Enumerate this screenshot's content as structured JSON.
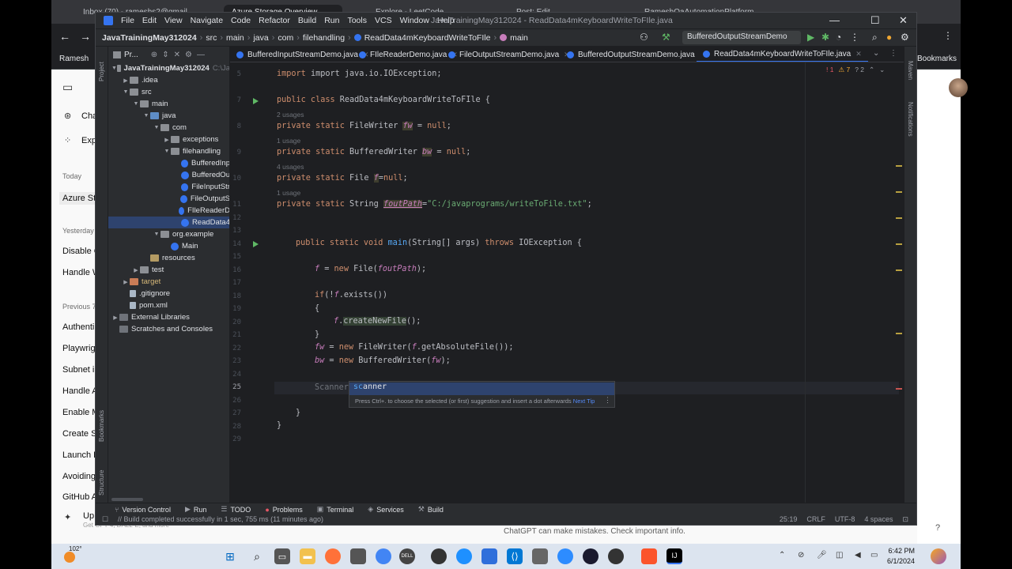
{
  "browser": {
    "tabs": [
      {
        "label": "Inbox (70) - rameshs2@gmail..."
      },
      {
        "label": "Azure Storage Overview"
      },
      {
        "label": "Explore - LeetCode"
      },
      {
        "label": "Post: Edit"
      },
      {
        "label": "RameshQaAutomationPlatform"
      }
    ],
    "bookmarks_left": "Ramesh",
    "bookmarks_right": "Bookmarks"
  },
  "chat_sidebar": {
    "top_items": [
      "Cha",
      "Exp"
    ],
    "sections": [
      {
        "heading": "Today",
        "items": [
          "Azure Sto"
        ]
      },
      {
        "heading": "Yesterday",
        "items": [
          "Disable C",
          "Handle W"
        ]
      },
      {
        "heading": "Previous 7",
        "items": [
          "Authenti",
          "Playwrigh",
          "Subnet in",
          "Handle A",
          "Enable M",
          "Create SC",
          "Launch B",
          "Avoiding",
          "GitHub A"
        ]
      }
    ],
    "upgrade_label": "Up",
    "upgrade_sub": "Get GPT-4, DALL·E, and more",
    "footer": "ChatGPT can make mistakes. Check important info."
  },
  "ide": {
    "menu": [
      "File",
      "Edit",
      "View",
      "Navigate",
      "Code",
      "Refactor",
      "Build",
      "Run",
      "Tools",
      "VCS",
      "Window",
      "Help"
    ],
    "window_title": "JavaTrainingMay312024 - ReadData4mKeyboardWriteToFIle.java",
    "breadcrumbs": [
      "JavaTrainingMay312024",
      "src",
      "main",
      "java",
      "com",
      "filehandling",
      "ReadData4mKeyboardWriteToFIle",
      "main"
    ],
    "run_config": "BufferedOutputStreamDemo",
    "project_header": "Pr...",
    "project_tree": [
      {
        "label": "JavaTrainingMay312024",
        "suffix": "C:\\Ja",
        "depth": 0,
        "icon": "folder",
        "expanded": true
      },
      {
        "label": ".idea",
        "depth": 1,
        "icon": "folder",
        "expanded": false
      },
      {
        "label": "src",
        "depth": 1,
        "icon": "folder",
        "expanded": true
      },
      {
        "label": "main",
        "depth": 2,
        "icon": "folder",
        "expanded": true
      },
      {
        "label": "java",
        "depth": 3,
        "icon": "src",
        "expanded": true
      },
      {
        "label": "com",
        "depth": 4,
        "icon": "folder",
        "expanded": true
      },
      {
        "label": "exceptions",
        "depth": 5,
        "icon": "folder",
        "expanded": false
      },
      {
        "label": "filehandling",
        "depth": 5,
        "icon": "folder",
        "expanded": true
      },
      {
        "label": "BufferedInp",
        "depth": 6,
        "icon": "cls"
      },
      {
        "label": "BufferedOu",
        "depth": 6,
        "icon": "cls"
      },
      {
        "label": "FileInputStr",
        "depth": 6,
        "icon": "cls"
      },
      {
        "label": "FileOutputS",
        "depth": 6,
        "icon": "cls"
      },
      {
        "label": "FIleReaderD",
        "depth": 6,
        "icon": "cls"
      },
      {
        "label": "ReadData4",
        "depth": 6,
        "icon": "cls",
        "selected": true
      },
      {
        "label": "org.example",
        "depth": 4,
        "icon": "folder",
        "expanded": true
      },
      {
        "label": "Main",
        "depth": 5,
        "icon": "cls"
      },
      {
        "label": "resources",
        "depth": 3,
        "icon": "res"
      },
      {
        "label": "test",
        "depth": 2,
        "icon": "folder",
        "expanded": false
      },
      {
        "label": "target",
        "depth": 1,
        "icon": "excl",
        "expanded": false,
        "target": true
      },
      {
        "label": ".gitignore",
        "depth": 1,
        "icon": "file"
      },
      {
        "label": "pom.xml",
        "depth": 1,
        "icon": "file"
      },
      {
        "label": "External Libraries",
        "depth": 0,
        "icon": "lib",
        "expanded": false
      },
      {
        "label": "Scratches and Consoles",
        "depth": 0,
        "icon": "lib"
      }
    ],
    "editor_tabs": [
      {
        "label": "BufferedInputStreamDemo.java",
        "active": false
      },
      {
        "label": "FIleReaderDemo.java",
        "active": false
      },
      {
        "label": "FileOutputStreamDemo.java",
        "active": false
      },
      {
        "label": "BufferedOutputStreamDemo.java",
        "active": false
      },
      {
        "label": "ReadData4mKeyboardWriteToFIle.java",
        "active": true
      }
    ],
    "inspections": {
      "errors": "1",
      "warnings": "7",
      "weak": "2"
    },
    "code": {
      "line5": "import java.io.IOException;",
      "usages_fw": "2 usages",
      "usages_bw": "1 usage",
      "usages_f": "4 usages",
      "usages_path": "1 usage",
      "path_value": "\"C:/javaprograms/writeToFile.txt\"",
      "typed_type": "Scanner",
      "typed_text": "sc"
    },
    "line_numbers": [
      "5",
      "7",
      "8",
      "9",
      "10",
      "11",
      "12",
      "13",
      "14",
      "15",
      "16",
      "17",
      "18",
      "19",
      "20",
      "21",
      "22",
      "23",
      "24",
      "25",
      "26",
      "27",
      "28",
      "29"
    ],
    "completion": {
      "item_match": "sc",
      "item_rest": "anner",
      "tip": "Press Ctrl+. to choose the selected (or first) suggestion and insert a dot afterwards",
      "next_tip": "Next Tip"
    },
    "toolwindows": [
      "Version Control",
      "Run",
      "TODO",
      "Problems",
      "Terminal",
      "Services",
      "Build"
    ],
    "status": {
      "message": "Build completed successfully in 1 sec, 755 ms (11 minutes ago)",
      "position": "25:19",
      "line_sep": "CRLF",
      "encoding": "UTF-8",
      "indent": "4 spaces"
    },
    "side_labels": {
      "project": "Project",
      "bookmarks": "Bookmarks",
      "structure": "Structure",
      "maven": "Maven",
      "notifications": "Notifications"
    }
  },
  "taskbar": {
    "weather": "102°",
    "time": "6:42 PM",
    "date": "6/1/2024"
  },
  "colors": {
    "ide_bg": "#1e1f22",
    "keyword": "#cf8e6d",
    "field": "#c77dbb",
    "string": "#6aab73",
    "method": "#56a8f5",
    "accent": "#3574f0"
  }
}
